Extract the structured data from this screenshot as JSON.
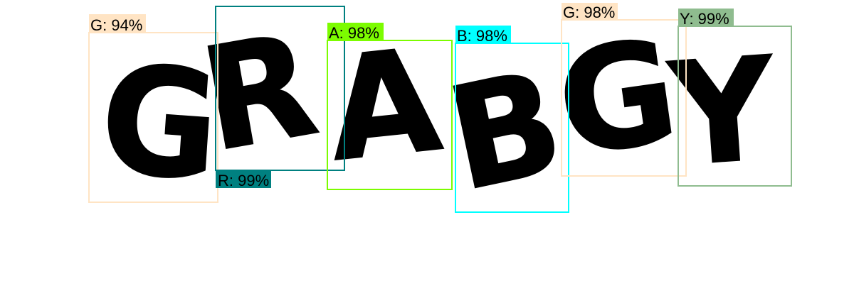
{
  "detections": [
    {
      "label": "G: 94%",
      "color": "#FFE4C4"
    },
    {
      "label": "R: 99%",
      "color": "#008080"
    },
    {
      "label": "A: 98%",
      "color": "#7CFC00"
    },
    {
      "label": "B: 98%",
      "color": "#00FFFF"
    },
    {
      "label": "G: 98%",
      "color": "#FFE4C4"
    },
    {
      "label": "Y: 99%",
      "color": "#8FBC8F"
    }
  ]
}
